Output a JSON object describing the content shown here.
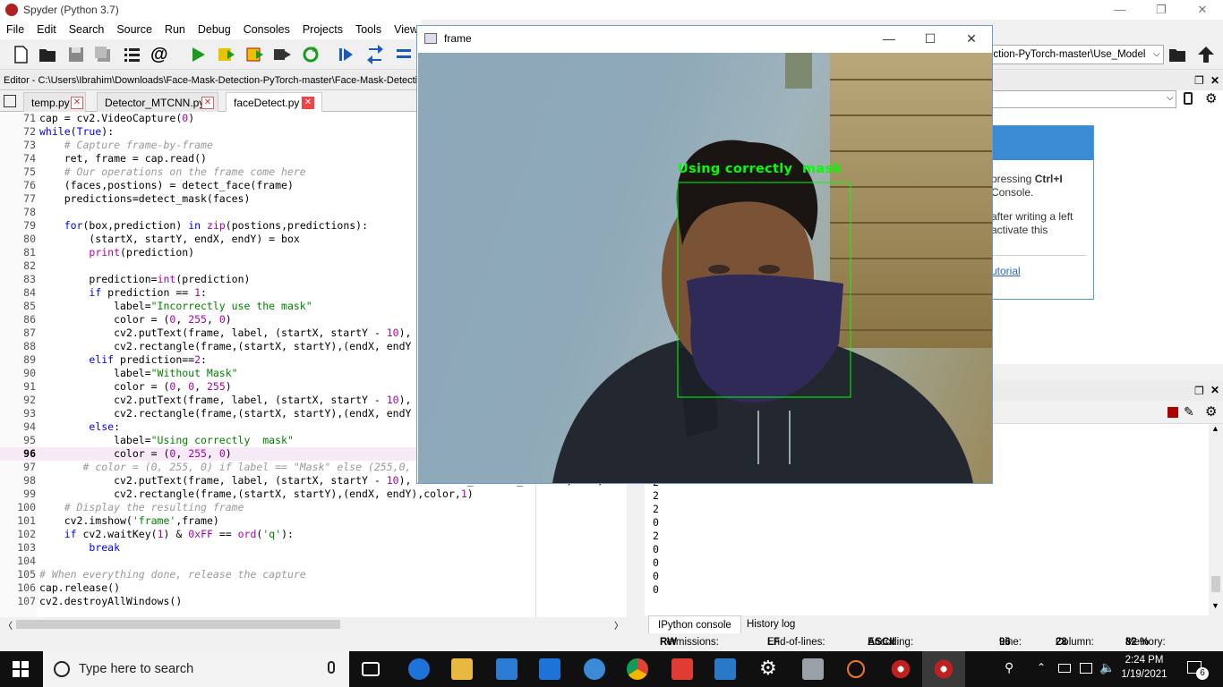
{
  "app": {
    "title": "Spyder (Python 3.7)"
  },
  "menu": [
    "File",
    "Edit",
    "Search",
    "Source",
    "Run",
    "Debug",
    "Consoles",
    "Projects",
    "Tools",
    "View"
  ],
  "editor": {
    "path": "Editor - C:\\Users\\Ibrahim\\Downloads\\Face-Mask-Detection-PyTorch-master\\Face-Mask-Detection-PyTorch-master\\Use_Model\\faceDetect.py",
    "tabs": [
      "temp.py",
      "Detector_MTCNN.py",
      "faceDetect.py"
    ]
  },
  "workdir": "ection-PyTorch-master\\Use_Model",
  "help": {
    "line1": "pressing ",
    "line1b": "Ctrl+I",
    "line2": "Console.",
    "line3": "after writing a left",
    "line4": "activate this",
    "link": "utorial"
  },
  "console": {
    "output": [
      "2",
      "2",
      "2",
      "0",
      "2",
      "0",
      "0",
      "0",
      "0"
    ],
    "tabs": [
      "IPython console",
      "History log"
    ]
  },
  "status": {
    "permissions_label": "Permissions:",
    "permissions": "RW",
    "eol_label": "End-of-lines:",
    "eol": "LF",
    "encoding_label": "Encoding:",
    "encoding": "ASCII",
    "line_label": "Line:",
    "line": "96",
    "column_label": "Column:",
    "column": "28",
    "memory_label": "Memory:",
    "memory": "82 %"
  },
  "frame_window": {
    "title": "frame",
    "overlay_label": "Using correctly  mask"
  },
  "taskbar": {
    "search_placeholder": "Type here to search",
    "time": "2:24 PM",
    "date": "1/19/2021",
    "notification_count": "6"
  },
  "colors": {
    "overlay_green": "#00ff00",
    "accent": "#3b8ad4"
  }
}
